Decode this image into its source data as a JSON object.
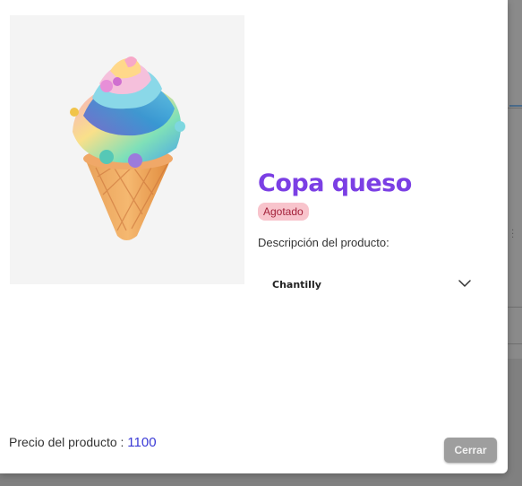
{
  "product": {
    "title": "Copa queso",
    "status": "Agotado",
    "image_icon": "ice-cream-cone-icon",
    "description_label": "Descripción del producto:",
    "description_select": {
      "selected": "Chantilly"
    },
    "price_label": "Precio del producto : ",
    "price_value": "1100"
  },
  "actions": {
    "close_label": "Cerrar"
  },
  "colors": {
    "title": "#7b3fe4",
    "badge_bg": "#f8c4cc",
    "badge_text": "#a3213a",
    "price_value": "#3a3ad6",
    "close_button": "#9e9e9e"
  }
}
